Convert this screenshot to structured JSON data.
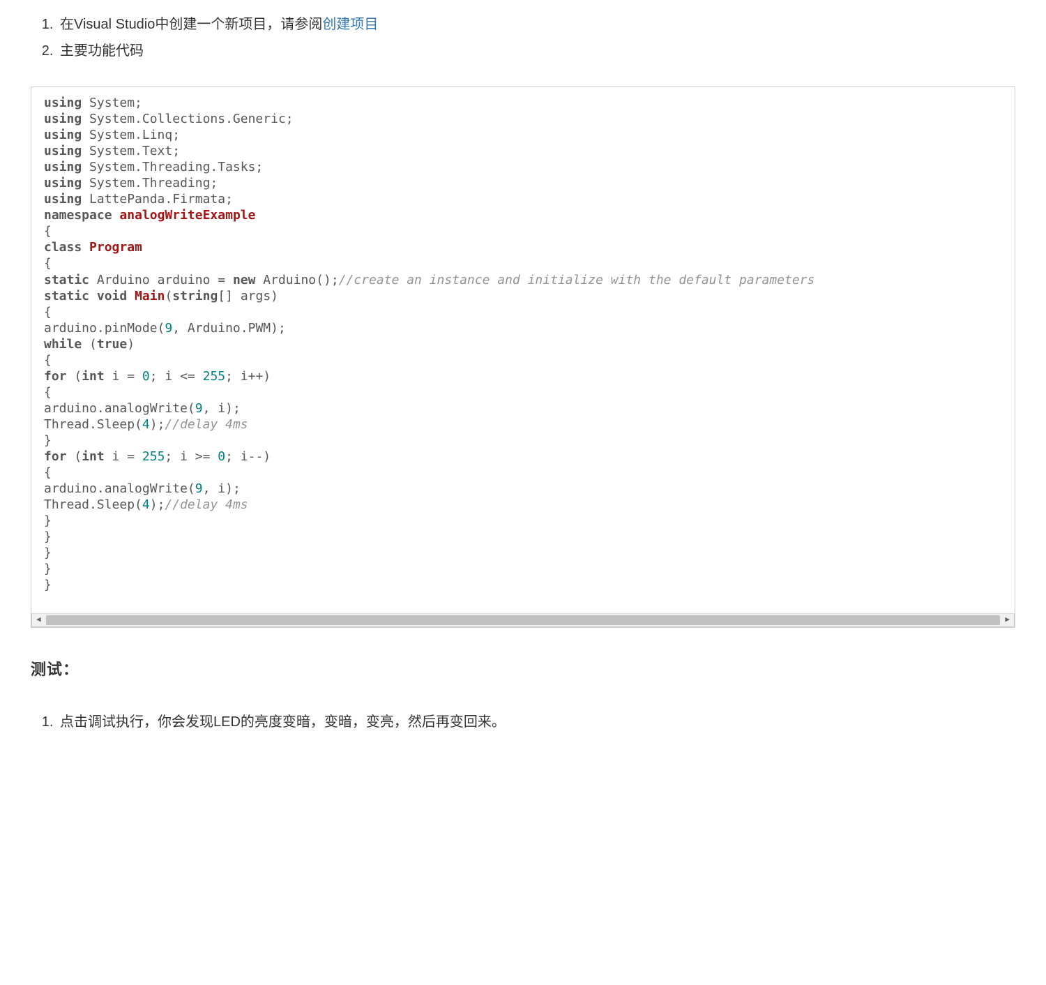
{
  "steps": {
    "item1_prefix": "在Visual Studio中创建一个新项目，请参阅",
    "item1_link": "创建项目",
    "item2": "主要功能代码"
  },
  "code": {
    "lines": [
      [
        {
          "t": "kw",
          "v": "using"
        },
        {
          "t": "p",
          "v": " System;"
        }
      ],
      [
        {
          "t": "kw",
          "v": "using"
        },
        {
          "t": "p",
          "v": " System.Collections.Generic;"
        }
      ],
      [
        {
          "t": "kw",
          "v": "using"
        },
        {
          "t": "p",
          "v": " System.Linq;"
        }
      ],
      [
        {
          "t": "kw",
          "v": "using"
        },
        {
          "t": "p",
          "v": " System.Text;"
        }
      ],
      [
        {
          "t": "kw",
          "v": "using"
        },
        {
          "t": "p",
          "v": " System.Threading.Tasks;"
        }
      ],
      [
        {
          "t": "kw",
          "v": "using"
        },
        {
          "t": "p",
          "v": " System.Threading;"
        }
      ],
      [
        {
          "t": "kw",
          "v": "using"
        },
        {
          "t": "p",
          "v": " LattePanda.Firmata;"
        }
      ],
      [
        {
          "t": "kw",
          "v": "namespace"
        },
        {
          "t": "p",
          "v": " "
        },
        {
          "t": "name",
          "v": "analogWriteExample"
        }
      ],
      [
        {
          "t": "p",
          "v": "{"
        }
      ],
      [
        {
          "t": "kw",
          "v": "class"
        },
        {
          "t": "p",
          "v": " "
        },
        {
          "t": "name",
          "v": "Program"
        }
      ],
      [
        {
          "t": "p",
          "v": "{"
        }
      ],
      [
        {
          "t": "kw",
          "v": "static"
        },
        {
          "t": "p",
          "v": " Arduino arduino = "
        },
        {
          "t": "kw",
          "v": "new"
        },
        {
          "t": "p",
          "v": " Arduino();"
        },
        {
          "t": "cmt",
          "v": "//create an instance and initialize with the default parameters"
        }
      ],
      [
        {
          "t": "kw",
          "v": "static"
        },
        {
          "t": "p",
          "v": " "
        },
        {
          "t": "kw",
          "v": "void"
        },
        {
          "t": "p",
          "v": " "
        },
        {
          "t": "name",
          "v": "Main"
        },
        {
          "t": "p",
          "v": "("
        },
        {
          "t": "kw",
          "v": "string"
        },
        {
          "t": "p",
          "v": "[] args)"
        }
      ],
      [
        {
          "t": "p",
          "v": "{"
        }
      ],
      [
        {
          "t": "p",
          "v": "arduino.pinMode("
        },
        {
          "t": "num",
          "v": "9"
        },
        {
          "t": "p",
          "v": ", Arduino.PWM);"
        }
      ],
      [
        {
          "t": "kw",
          "v": "while"
        },
        {
          "t": "p",
          "v": " ("
        },
        {
          "t": "bool",
          "v": "true"
        },
        {
          "t": "p",
          "v": ")"
        }
      ],
      [
        {
          "t": "p",
          "v": "{"
        }
      ],
      [
        {
          "t": "kw",
          "v": "for"
        },
        {
          "t": "p",
          "v": " ("
        },
        {
          "t": "kw",
          "v": "int"
        },
        {
          "t": "p",
          "v": " i = "
        },
        {
          "t": "num",
          "v": "0"
        },
        {
          "t": "p",
          "v": "; i <= "
        },
        {
          "t": "num",
          "v": "255"
        },
        {
          "t": "p",
          "v": "; i++)"
        }
      ],
      [
        {
          "t": "p",
          "v": "{"
        }
      ],
      [
        {
          "t": "p",
          "v": "arduino.analogWrite("
        },
        {
          "t": "num",
          "v": "9"
        },
        {
          "t": "p",
          "v": ", i);"
        }
      ],
      [
        {
          "t": "p",
          "v": "Thread.Sleep("
        },
        {
          "t": "num",
          "v": "4"
        },
        {
          "t": "p",
          "v": ");"
        },
        {
          "t": "cmt",
          "v": "//delay 4ms"
        }
      ],
      [
        {
          "t": "p",
          "v": "}"
        }
      ],
      [
        {
          "t": "kw",
          "v": "for"
        },
        {
          "t": "p",
          "v": " ("
        },
        {
          "t": "kw",
          "v": "int"
        },
        {
          "t": "p",
          "v": " i = "
        },
        {
          "t": "num",
          "v": "255"
        },
        {
          "t": "p",
          "v": "; i >= "
        },
        {
          "t": "num",
          "v": "0"
        },
        {
          "t": "p",
          "v": "; i--)"
        }
      ],
      [
        {
          "t": "p",
          "v": "{"
        }
      ],
      [
        {
          "t": "p",
          "v": "arduino.analogWrite("
        },
        {
          "t": "num",
          "v": "9"
        },
        {
          "t": "p",
          "v": ", i);"
        }
      ],
      [
        {
          "t": "p",
          "v": "Thread.Sleep("
        },
        {
          "t": "num",
          "v": "4"
        },
        {
          "t": "p",
          "v": ");"
        },
        {
          "t": "cmt",
          "v": "//delay 4ms"
        }
      ],
      [
        {
          "t": "p",
          "v": "}"
        }
      ],
      [
        {
          "t": "p",
          "v": "}"
        }
      ],
      [
        {
          "t": "p",
          "v": "}"
        }
      ],
      [
        {
          "t": "p",
          "v": "}"
        }
      ],
      [
        {
          "t": "p",
          "v": "}"
        }
      ]
    ]
  },
  "test": {
    "heading": "测试：",
    "item1": "点击调试执行，你会发现LED的亮度变暗，变暗，变亮，然后再变回来。"
  }
}
